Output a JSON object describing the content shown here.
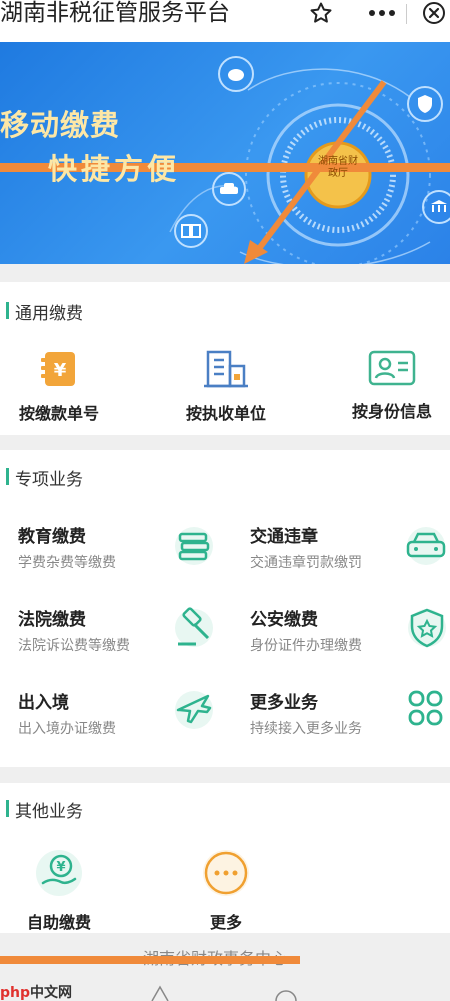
{
  "header": {
    "title": "湖南非税征管服务平台",
    "star_icon": "star-outline",
    "more_icon": "ellipsis",
    "close_icon": "close-circle"
  },
  "banner": {
    "title": "移动缴费",
    "subtitle": "快捷方便",
    "emblem_text": "湖南省财政厅",
    "background": "#2a86e8",
    "text_color": "#fde7a6"
  },
  "general": {
    "title": "通用缴费",
    "items": [
      {
        "label": "按缴款单号",
        "icon": "receipt-yuan"
      },
      {
        "label": "按执收单位",
        "icon": "building"
      },
      {
        "label": "按身份信息",
        "icon": "id-card"
      }
    ]
  },
  "special": {
    "title": "专项业务",
    "items": [
      {
        "title": "教育缴费",
        "desc": "学费杂费等缴费",
        "icon": "books"
      },
      {
        "title": "交通违章",
        "desc": "交通违章罚款缴罚",
        "icon": "car"
      },
      {
        "title": "法院缴费",
        "desc": "法院诉讼费等缴费",
        "icon": "gavel"
      },
      {
        "title": "公安缴费",
        "desc": "身份证件办理缴费",
        "icon": "police-shield"
      },
      {
        "title": "出入境",
        "desc": "出入境办证缴费",
        "icon": "airplane"
      },
      {
        "title": "更多业务",
        "desc": "持续接入更多业务",
        "icon": "four-squares"
      }
    ]
  },
  "other": {
    "title": "其他业务",
    "items": [
      {
        "label": "自助缴费",
        "icon": "hand-yuan"
      },
      {
        "label": "更多",
        "icon": "ellipsis-circle"
      }
    ]
  },
  "footer": {
    "text": "湖南省财政事务中心"
  },
  "watermark": {
    "text_red": "php",
    "text_black": "中文网"
  },
  "colors": {
    "accent_green": "#2eb38e",
    "icon_orange": "#f0a030",
    "icon_blue": "#4a7fc4",
    "overlay_orange": "#f08a3a"
  }
}
